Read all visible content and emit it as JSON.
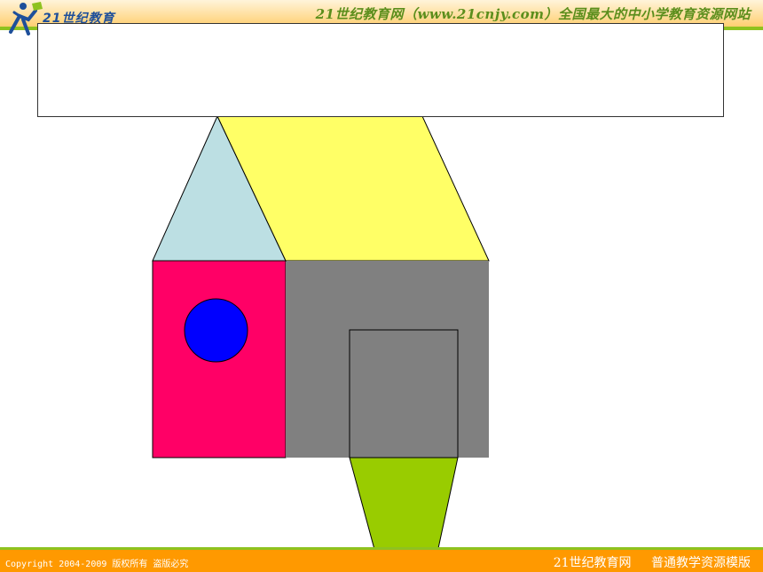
{
  "header": {
    "logo_text": "21世纪教育",
    "site_title": "21世纪教育网（www.21cnjy.com）全国最大的中小学教育资源网站"
  },
  "title_box": {
    "text": ""
  },
  "footer": {
    "copyright": "Copyright 2004-2009 版权所有 盗版必究",
    "site_name": "21世纪教育网",
    "template_name": "普通教学资源模版"
  },
  "colors": {
    "header_band": "#ffcf70",
    "accent_green": "#8ec21f",
    "footer_band": "#ff9900",
    "triangle": "#bcdfe3",
    "parallelogram": "#ffff66",
    "left_rectangle": "#ff0066",
    "circle": "#0000ff",
    "right_rectangle": "#808080",
    "inner_square": "#808080",
    "trapezoid": "#99cc00"
  },
  "shapes": [
    "triangle",
    "parallelogram",
    "rectangle",
    "circle",
    "rectangle",
    "square",
    "trapezoid"
  ]
}
